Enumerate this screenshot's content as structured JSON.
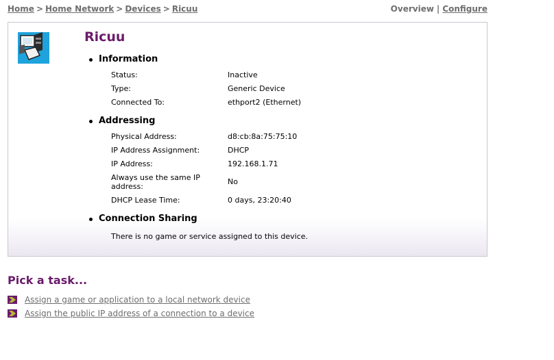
{
  "breadcrumb": {
    "items": [
      "Home",
      "Home Network",
      "Devices",
      "Ricuu"
    ],
    "separator": ">"
  },
  "view_links": {
    "overview": "Overview",
    "separator": "|",
    "configure": "Configure"
  },
  "device": {
    "name": "Ricuu",
    "icon": "computer-device-icon"
  },
  "sections": {
    "information": {
      "title": "Information",
      "rows": [
        {
          "label": "Status:",
          "value": "Inactive"
        },
        {
          "label": "Type:",
          "value": "Generic Device"
        },
        {
          "label": "Connected To:",
          "value": "ethport2 (Ethernet)"
        }
      ]
    },
    "addressing": {
      "title": "Addressing",
      "rows": [
        {
          "label": "Physical Address:",
          "value": "d8:cb:8a:75:75:10"
        },
        {
          "label": "IP Address Assignment:",
          "value": "DHCP"
        },
        {
          "label": "IP Address:",
          "value": "192.168.1.71"
        },
        {
          "label": "Always use the same IP address:",
          "value": "No"
        },
        {
          "label": "DHCP Lease Time:",
          "value": "0 days, 23:20:40"
        }
      ]
    },
    "connection_sharing": {
      "title": "Connection Sharing",
      "note": "There is no game or service assigned to this device."
    }
  },
  "tasks": {
    "title": "Pick a task...",
    "items": [
      {
        "label": "Assign a game or application to a local network device"
      },
      {
        "label": "Assign the public IP address of a connection to a device"
      }
    ]
  },
  "colors": {
    "accent_purple": "#6a1b6a",
    "link_gray": "#6e6e6e",
    "panel_border": "#c9c6cf",
    "panel_gradient_end": "#ebe7f1",
    "task_arrow": "#b5b83a"
  }
}
